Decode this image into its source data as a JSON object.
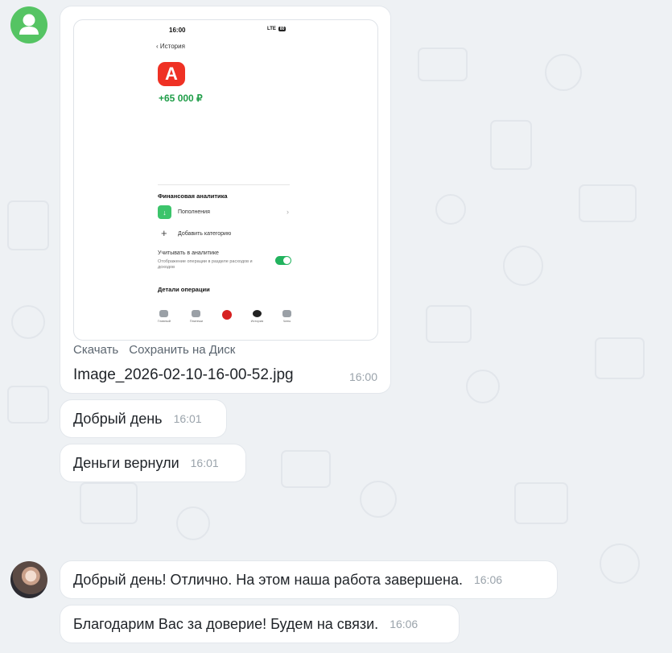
{
  "colors": {
    "accent_green": "#55c463",
    "alfa_red": "#ef3124",
    "amount_green": "#1f9d48",
    "toggle_green": "#22b35e"
  },
  "incoming": {
    "avatar_icon": "user-icon",
    "file_message": {
      "actions": {
        "download": "Скачать",
        "save_to_disk": "Сохранить на Диск"
      },
      "file_name": "Image_2026-02-10-16-00-52.jpg",
      "time": "16:00",
      "preview": {
        "status_time": "16:00",
        "status_network": "LTE",
        "status_battery": "80",
        "back_label": "История",
        "logo_letter": "А",
        "amount": "+65 000 ₽",
        "section_title": "Финансовая аналитика",
        "category": "Пополнения",
        "add_category": "Добавить категорию",
        "analytics_label": "Учитывать в аналитике",
        "analytics_note": "Отображение операции в разделе расходов и доходов",
        "analytics_enabled": true,
        "details_title": "Детали операции",
        "tabs": [
          "Главный",
          "Платежи",
          "",
          "История",
          "Чаты"
        ]
      }
    },
    "messages": [
      {
        "text": "Добрый день",
        "time": "16:01"
      },
      {
        "text": "Деньги вернули",
        "time": "16:01"
      }
    ]
  },
  "outgoing": {
    "messages": [
      {
        "text": "Добрый день! Отлично. На этом наша работа завершена.",
        "time": "16:06"
      },
      {
        "text": "Благодарим Вас за доверие! Будем на связи.",
        "time": "16:06"
      }
    ]
  }
}
